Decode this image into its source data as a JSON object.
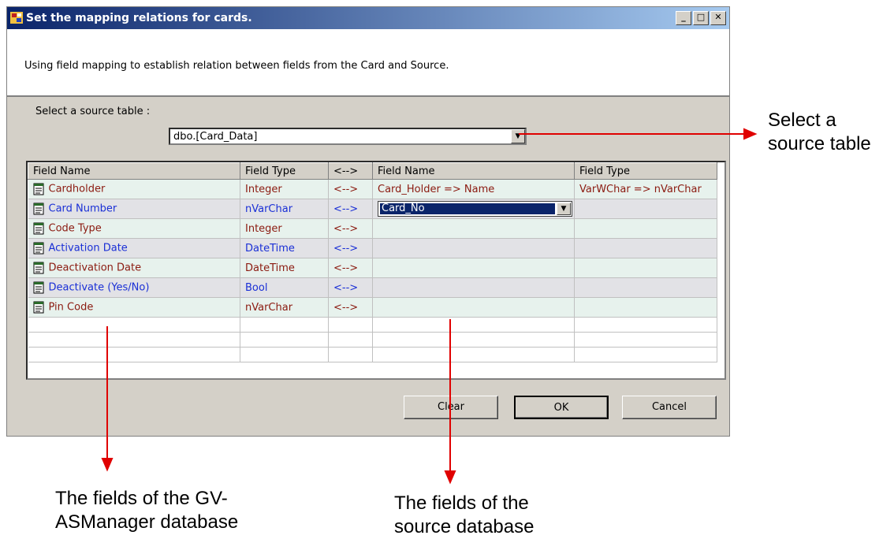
{
  "dialog": {
    "title": "Set the mapping relations for cards.",
    "description": "Using field mapping to establish relation between fields from the Card and Source.",
    "source_label": "Select a source table :",
    "source_value": "dbo.[Card_Data]"
  },
  "grid": {
    "headers": [
      "Field Name",
      "Field Type",
      "<-->",
      "Field Name",
      "Field Type"
    ],
    "rows": [
      {
        "name": "Cardholder",
        "type": "Integer",
        "arrow": "<-->",
        "src_name": "Card_Holder => Name",
        "src_type": "VarWChar => nVarChar",
        "color": "#8b1a10"
      },
      {
        "name": "Card Number",
        "type": "nVarChar",
        "arrow": "<-->",
        "src_name": "Card_No",
        "src_type": "",
        "color": "#1a2fd6"
      },
      {
        "name": "Code Type",
        "type": "Integer",
        "arrow": "<-->",
        "src_name": "",
        "src_type": "",
        "color": "#8b1a10"
      },
      {
        "name": "Activation Date",
        "type": "DateTime",
        "arrow": "<-->",
        "src_name": "",
        "src_type": "",
        "color": "#1a2fd6"
      },
      {
        "name": "Deactivation Date",
        "type": "DateTime",
        "arrow": "<-->",
        "src_name": "",
        "src_type": "",
        "color": "#8b1a10"
      },
      {
        "name": "Deactivate (Yes/No)",
        "type": "Bool",
        "arrow": "<-->",
        "src_name": "",
        "src_type": "",
        "color": "#1a2fd6"
      },
      {
        "name": "Pin Code",
        "type": "nVarChar",
        "arrow": "<-->",
        "src_name": "",
        "src_type": "",
        "color": "#8b1a10"
      }
    ]
  },
  "buttons": {
    "clear": "Clear",
    "ok": "OK",
    "cancel": "Cancel"
  },
  "annotations": {
    "select_table": [
      "Select a",
      "source table"
    ],
    "gv_fields": [
      "The fields of the GV-",
      "ASManager database"
    ],
    "source_fields": [
      "The fields of the",
      "source database"
    ]
  },
  "colors": {
    "arrow": "#e00000",
    "title_start": "#0a246a",
    "title_end": "#a6caf0"
  }
}
